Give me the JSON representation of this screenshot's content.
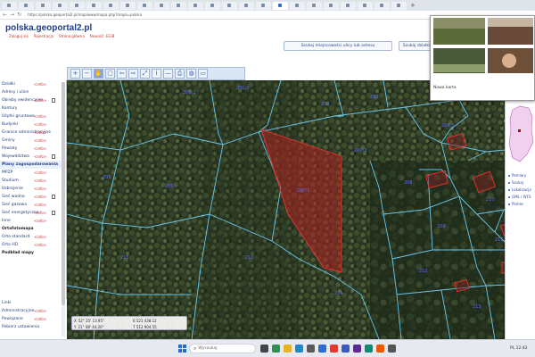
{
  "browser": {
    "url": "https://polska.geoportal2.pl/map/www/mapa.php?mapa=polska",
    "tabs": [
      {
        "label": "",
        "active": false
      },
      {
        "label": "",
        "active": false
      },
      {
        "label": "",
        "active": false
      },
      {
        "label": "",
        "active": false
      },
      {
        "label": "",
        "active": false
      },
      {
        "label": "",
        "active": false
      },
      {
        "label": "",
        "active": false
      },
      {
        "label": "",
        "active": false
      },
      {
        "label": "",
        "active": false
      },
      {
        "label": "",
        "active": false
      },
      {
        "label": "",
        "active": false
      },
      {
        "label": "",
        "active": false
      },
      {
        "label": "",
        "active": false
      },
      {
        "label": "",
        "active": false
      },
      {
        "label": "",
        "active": false
      },
      {
        "label": "",
        "active": false
      },
      {
        "label": "",
        "active": true
      },
      {
        "label": "",
        "active": false
      },
      {
        "label": "",
        "active": false
      },
      {
        "label": "",
        "active": false
      },
      {
        "label": "",
        "active": false
      },
      {
        "label": "",
        "active": false
      },
      {
        "label": "",
        "active": false
      },
      {
        "label": "",
        "active": false
      }
    ],
    "new_tab": "+"
  },
  "site": {
    "logo": "polska.geoportal2.pl",
    "nav": [
      "Zaloguj się",
      "Rejestracja",
      "Strona główna",
      "Nowość: EGiB"
    ],
    "header_buttons": [
      "Szukaj miejscowości ulicy lub adresu",
      "Szukaj działki"
    ]
  },
  "toolbar": {
    "icons": [
      "zoom-in-icon",
      "zoom-out-icon",
      "pan-hand-icon",
      "zoom-window-icon",
      "arrow-left-icon",
      "arrow-right-icon",
      "measure-icon",
      "info-icon",
      "ruler-icon",
      "print-icon",
      "globe-icon",
      "window-icon"
    ],
    "glyphs": [
      "+",
      "−",
      "✋",
      "▢",
      "⇦",
      "⇨",
      "⤢",
      "i",
      "—",
      "⎙",
      "◍",
      "▭"
    ]
  },
  "layers": [
    {
      "label": "Działki",
      "info": "<info>",
      "doc": false,
      "type": "item"
    },
    {
      "label": "Adresy i ulice",
      "info": "",
      "doc": false,
      "type": "item"
    },
    {
      "label": "Obręby ewidencyjne",
      "info": "<info>",
      "doc": true,
      "type": "item"
    },
    {
      "label": "Kontury",
      "info": "",
      "doc": false,
      "type": "item"
    },
    {
      "label": "Użytki gruntowe",
      "info": "<info>",
      "doc": false,
      "type": "item"
    },
    {
      "label": "Budynki",
      "info": "<info>",
      "doc": false,
      "type": "item"
    },
    {
      "label": "Granice administracyjne",
      "info": "<info>",
      "doc": false,
      "type": "item"
    },
    {
      "label": "Gminy",
      "info": "<info>",
      "doc": false,
      "type": "item"
    },
    {
      "label": "Powiaty",
      "info": "<info>",
      "doc": false,
      "type": "item"
    },
    {
      "label": "Województwa",
      "info": "<info>",
      "doc": true,
      "type": "item"
    },
    {
      "label": "Plany zagospodarowania",
      "info": "",
      "doc": false,
      "type": "hl"
    },
    {
      "label": "MPZP",
      "info": "<info>",
      "doc": false,
      "type": "item"
    },
    {
      "label": "Studium",
      "info": "<info>",
      "doc": false,
      "type": "item"
    },
    {
      "label": "Uzbrojenie",
      "info": "<info>",
      "doc": false,
      "type": "item"
    },
    {
      "label": "Sieć wodna",
      "info": "<info>",
      "doc": true,
      "type": "item"
    },
    {
      "label": "Sieć gazowa",
      "info": "<info>",
      "doc": false,
      "type": "item"
    },
    {
      "label": "Sieć energetyczna",
      "info": "<info>",
      "doc": true,
      "type": "item"
    },
    {
      "label": "Inne",
      "info": "<info>",
      "doc": false,
      "type": "item"
    },
    {
      "label": "Ortofotomapa",
      "info": "",
      "doc": false,
      "type": "group"
    },
    {
      "label": "Orto standard",
      "info": "<info>",
      "doc": false,
      "type": "item"
    },
    {
      "label": "Orto HD",
      "info": "<info>",
      "doc": false,
      "type": "item"
    },
    {
      "label": "Podkład mapy",
      "info": "",
      "doc": false,
      "type": "group"
    }
  ],
  "panel_bottom": [
    {
      "label": "Linki",
      "info": ""
    },
    {
      "label": "Administracyjne",
      "info": "<info>"
    },
    {
      "label": "Powiązane",
      "info": "<info>"
    },
    {
      "label": "Pobierz ustawienia",
      "info": ""
    }
  ],
  "map": {
    "parcel_highlight_color": "#b02020",
    "parcel_labels": [
      "201/1",
      "201/2",
      "202",
      "203",
      "204/3",
      "205",
      "206",
      "207/1",
      "207/2",
      "208",
      "209",
      "210",
      "211",
      "212",
      "213",
      "214",
      "215",
      "216"
    ]
  },
  "coords": {
    "x_label": "X",
    "x_value": "52° 25' 13.95\"",
    "y_label": "Y",
    "y_value": "21° 08' 44.20\"",
    "x2_value": "6 521 438.12",
    "y2_value": "7 512 904.55"
  },
  "overlay": {
    "headline": "Nowa karta"
  },
  "right_panel": {
    "items": [
      "Pomiary",
      "Szukaj",
      "Lokalizacja",
      "GML / WFS",
      "Pomoc"
    ]
  },
  "taskbar": {
    "search_placeholder": "Wyszukaj",
    "icons": [
      "start-icon",
      "search-icon",
      "task-view-icon",
      "widgets-icon",
      "file-explorer-icon",
      "edge-icon",
      "store-icon",
      "mail-icon",
      "chrome-icon",
      "app-icon-1",
      "app-icon-2",
      "app-icon-3",
      "app-icon-4",
      "app-icon-5"
    ],
    "icon_colors": [
      "#1f6fd0",
      "#ffffff",
      "#444444",
      "#2f8f4f",
      "#e6b422",
      "#1e88c8",
      "#5a5a5a",
      "#2d6bd1",
      "#dd3b2f",
      "#3b5bbd",
      "#5c2d91",
      "#0a8c6f",
      "#e65c00",
      "#555555"
    ],
    "tray": "PL 12:42"
  }
}
